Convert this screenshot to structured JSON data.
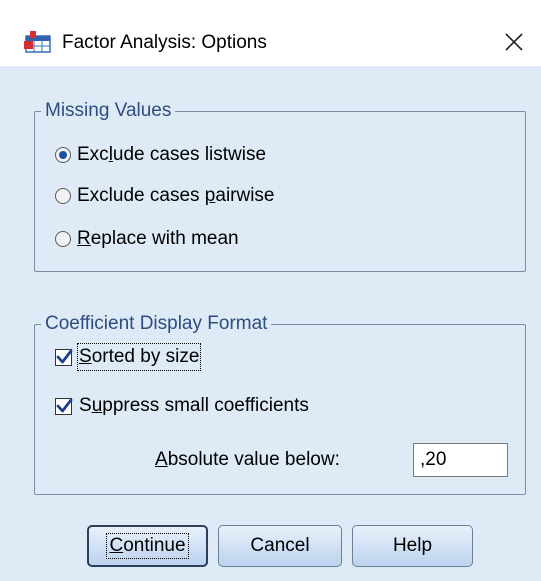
{
  "window": {
    "title": "Factor Analysis: Options",
    "close_glyph": "✕",
    "icon": "factor-analysis-app-icon"
  },
  "missing_values": {
    "legend": "Missing Values",
    "options": [
      {
        "pre": "Exc",
        "key": "l",
        "post": "ude cases listwise",
        "selected": true
      },
      {
        "pre": "Exclude cases ",
        "key": "p",
        "post": "airwise",
        "selected": false
      },
      {
        "pre": "",
        "key": "R",
        "post": "eplace with mean",
        "selected": false
      }
    ]
  },
  "coefficient_format": {
    "legend": "Coefficient Display Format",
    "sorted": {
      "pre": "",
      "key": "S",
      "post": "orted by size",
      "checked": true
    },
    "suppress": {
      "pre": "S",
      "key": "u",
      "post": "ppress small coefficients",
      "checked": true
    },
    "absolute_label": {
      "pre": "",
      "key": "A",
      "post": "bsolute value below:"
    },
    "absolute_value": ",20"
  },
  "buttons": {
    "continue": {
      "key": "C",
      "post": "ontinue"
    },
    "cancel": "Cancel",
    "help": "Help"
  },
  "colors": {
    "client_bg": "#dfeaf7",
    "legend_text": "#2d4d80",
    "accent": "#1f4ea8"
  }
}
